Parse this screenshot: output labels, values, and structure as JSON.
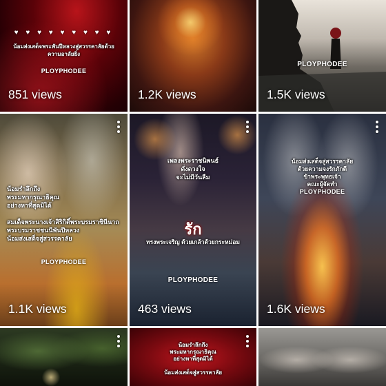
{
  "brand": "PLOYPHODEE",
  "tiles": [
    {
      "views": "851 views",
      "hearts": "♥ ♥ ♥ ♥ ♥ ♥ ♥ ♥ ♥",
      "caption": "น้อมส่งเสด็จพระพันปีหลวงสู่สวรรคาลัยด้วยความอาลัยยิ่ง"
    },
    {
      "views": "1.2K views"
    },
    {
      "views": "1.5K views"
    },
    {
      "views": "1.1K views",
      "caption": "น้อมรำลึกถึง\nพระมหากรุณาธิคุณ\nอย่างหาที่สุดมิได้\n\nสมเด็จพระนางเจ้าสิริกิติ์พระบรมราชินีนาถพระบรมราชชนนีพันปีหลวง\nน้อมส่งเสด็จสู่สวรรคาลัย"
    },
    {
      "views": "463 views",
      "caption": "เพลงพระราชนิพนธ์\nดั่งดวงใจ\nจะไม่มีวันลืม",
      "love": "รัก",
      "caption2": "ทรงพระเจริญ ด้วยเกล้าด้วยกระหม่อม"
    },
    {
      "views": "1.6K views",
      "caption": "น้อมส่งเสด็จสู่สวรรคาลัย\nด้วยความจงรักภักดี\nข้าพระพุทธเจ้า\nคณะผู้จัดทำ"
    },
    {
      "views": ""
    },
    {
      "views": "",
      "caption": "น้อมรำลึกถึง\nพระมหากรุณาธิคุณ\nอย่างหาที่สุดมิได้\n\nน้อมส่งเสด็จสู่สวรรคาลัย"
    },
    {
      "views": ""
    }
  ],
  "colors": {
    "overlay_text": "#ffffff",
    "divider": "#ffffff"
  }
}
